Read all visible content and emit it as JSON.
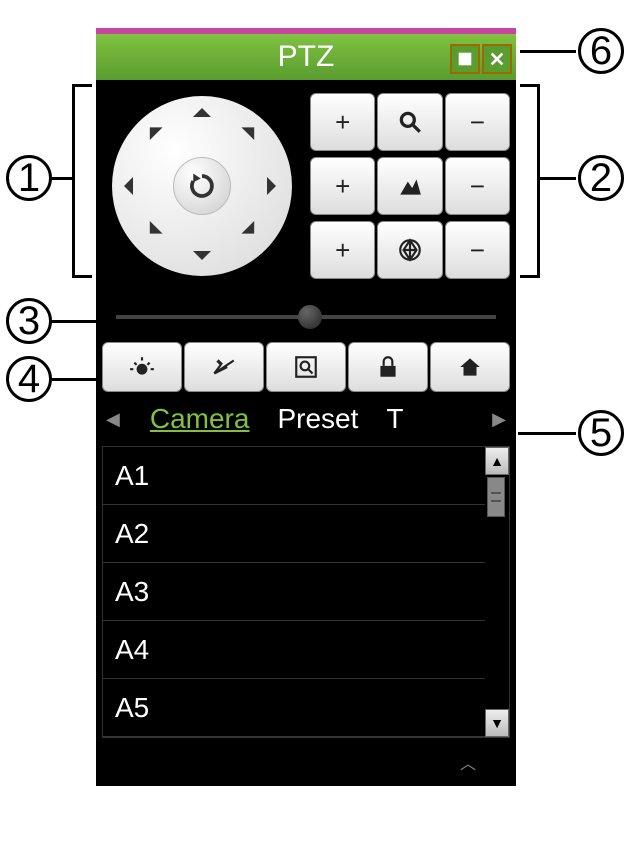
{
  "header": {
    "title": "PTZ"
  },
  "adjust": {
    "zoom": {
      "plus": "+",
      "minus": "−"
    },
    "focus": {
      "plus": "+",
      "minus": "−"
    },
    "iris": {
      "plus": "+",
      "minus": "−"
    }
  },
  "tabs": {
    "camera": "Camera",
    "preset": "Preset",
    "third": "T"
  },
  "cameras": [
    "A1",
    "A2",
    "A3",
    "A4",
    "A5"
  ],
  "callouts": {
    "c1": "1",
    "c2": "2",
    "c3": "3",
    "c4": "4",
    "c5": "5",
    "c6": "6"
  }
}
